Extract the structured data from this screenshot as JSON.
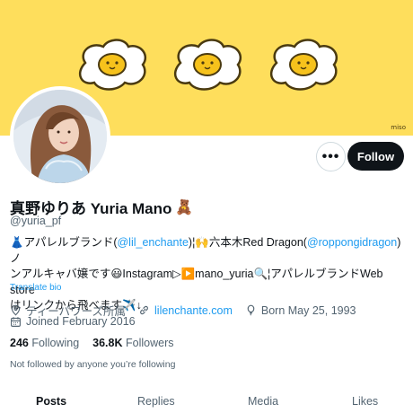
{
  "banner": {
    "signature": "miso",
    "colors": {
      "background": "#fede5c",
      "egg_white": "#ffffff",
      "yolk": "#f6c21c",
      "outline": "#4a3a10"
    }
  },
  "profile": {
    "display_name": "真野ゆりあ Yuria Mano",
    "name_emoji": "🧸",
    "handle": "@yuria_pf",
    "bio": {
      "l1_a": "👗アパレルブランド(",
      "l1_link1": "@lil_enchante",
      "l1_b": ")¦🙌六本木Red Dragon(",
      "l1_link2": "@roppongidragon",
      "l1_c": ")ノ",
      "l2": "ンアルキャバ嬢です😃Instagram▷▶️mano_yuria🔍¦アパレルブランドWeb store",
      "l3": "はリンクから飛べます✈️↓"
    },
    "translate_label": "Translate bio",
    "meta": {
      "location": "ティーパワーズ所属",
      "website": "lilenchante.com",
      "birthday": "Born May 25, 1993",
      "joined": "Joined February 2016"
    },
    "stats": {
      "following_count": "246",
      "following_label": "Following",
      "followers_count": "36.8K",
      "followers_label": "Followers"
    },
    "not_followed": "Not followed by anyone you’re following"
  },
  "actions": {
    "more_label": "•••",
    "follow_label": "Follow"
  },
  "tabs": [
    {
      "label": "Posts",
      "active": true
    },
    {
      "label": "Replies",
      "active": false
    },
    {
      "label": "Media",
      "active": false
    },
    {
      "label": "Likes",
      "active": false
    }
  ],
  "colors": {
    "link": "#1d9bf0",
    "muted": "#536471",
    "text": "#0f1419",
    "button": "#0f1419"
  }
}
